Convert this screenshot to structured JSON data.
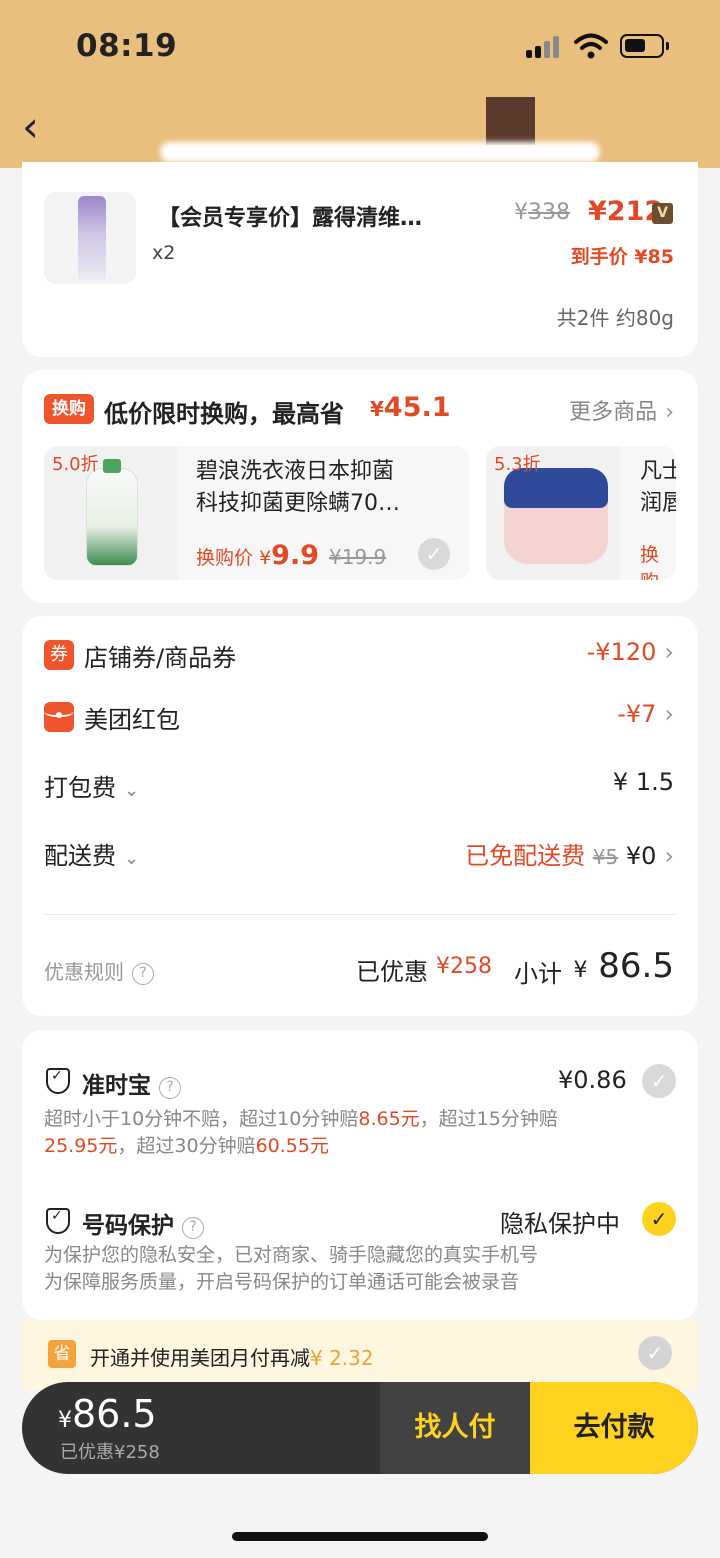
{
  "status_bar": {
    "time": "08:19"
  },
  "product": {
    "title": "【会员专享价】露得清维…",
    "qty": "x2",
    "orig_price_sym": "¥",
    "orig_price": "338",
    "price": "¥212",
    "vip_badge": "V",
    "final_price": "到手价 ¥85",
    "total": "共2件 约80g"
  },
  "exchange": {
    "badge": "换购",
    "title": "低价限时换购，最高省",
    "save_sym": "¥",
    "save": "45.1",
    "more": "更多商品",
    "items": [
      {
        "discount": "5.0折",
        "name_line1": "碧浪洗衣液日本抑菌",
        "name_line2": "科技抑菌更除螨70…",
        "price_label": "换购价",
        "price_sym": "¥",
        "price": "9.9",
        "old_price": "¥19.9"
      },
      {
        "discount": "5.3折",
        "name_line1": "凡士",
        "name_line2": "润唇",
        "price_label": "换购"
      }
    ]
  },
  "fees": {
    "coupon_icon": "券",
    "coupon_label": "店铺券/商品券",
    "coupon_value": "-¥120",
    "redpacket_label": "美团红包",
    "redpacket_value": "-¥7",
    "packing_label": "打包费",
    "packing_value": "¥ 1.5",
    "delivery_label": "配送费",
    "delivery_free": "已免配送费",
    "delivery_old": "¥5",
    "delivery_value": "¥0",
    "rules": "优惠规则",
    "saved_label": "已优惠",
    "saved_value": "¥258",
    "subtotal_label": "小计",
    "subtotal_sym": "¥",
    "subtotal": "86.5"
  },
  "insurance": {
    "title": "准时宝",
    "price": "¥0.86",
    "desc_a": "超时小于10分钟不赔，超过10分钟赔",
    "desc_b": "8.65元",
    "desc_c": "，超过15分钟赔",
    "desc_d": "25.95元",
    "desc_e": "，超过30分钟赔",
    "desc_f": "60.55元"
  },
  "privacy": {
    "title": "号码保护",
    "status": "隐私保护中",
    "desc1": "为保护您的隐私安全，已对商家、骑手隐藏您的真实手机号",
    "desc2": "为保障服务质量，开启号码保护的订单通话可能会被录音"
  },
  "monthly_pay": {
    "icon": "省",
    "text": "开通并使用美团月付再减",
    "value": "¥ 2.32"
  },
  "bottom_bar": {
    "total_sym": "¥",
    "total": "86.5",
    "saved": "已优惠¥258",
    "friend_pay": "找人付",
    "pay": "去付款"
  },
  "colors": {
    "header_bg": "#e9bf7e",
    "accent_red": "#e24a26",
    "accent_yellow": "#ffd21f"
  }
}
